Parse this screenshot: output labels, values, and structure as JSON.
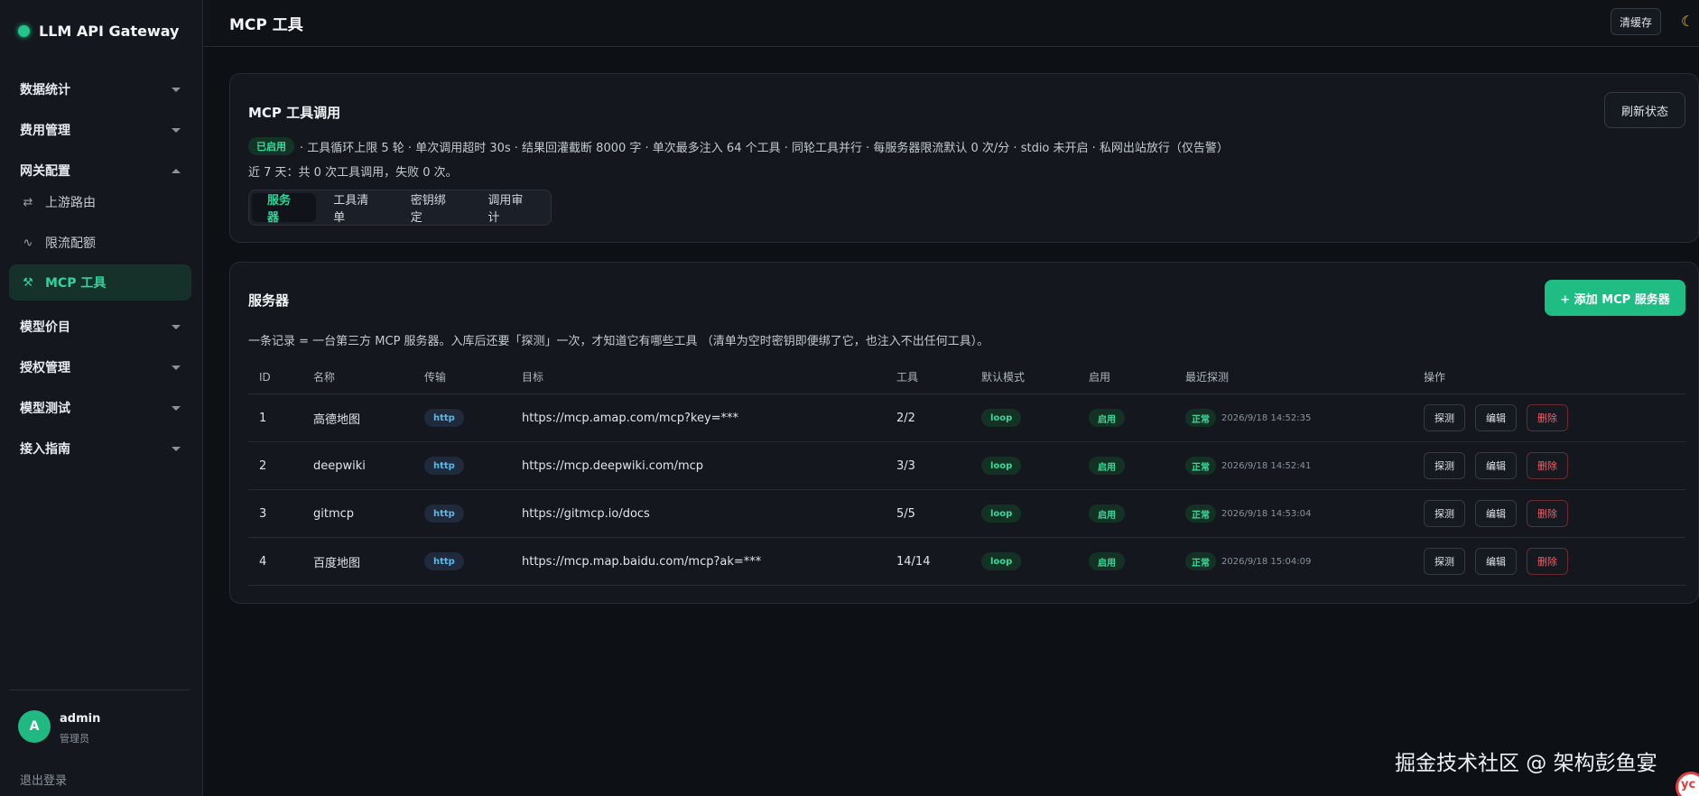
{
  "app": {
    "title": "LLM API Gateway",
    "theme_accent": "#22c58a"
  },
  "sidebar": {
    "groups": [
      {
        "label": "数据统计"
      },
      {
        "label": "费用管理"
      },
      {
        "label": "网关配置",
        "expanded": true
      },
      {
        "label": "模型价目"
      },
      {
        "label": "授权管理"
      },
      {
        "label": "模型测试"
      },
      {
        "label": "接入指南"
      }
    ],
    "sub_items": [
      {
        "label": "上游路由",
        "icon": "swap-icon"
      },
      {
        "label": "限流配额",
        "icon": "wave-icon"
      },
      {
        "label": "MCP 工具",
        "icon": "tools-icon",
        "active": true
      }
    ],
    "user": {
      "avatar": "A",
      "name": "admin",
      "role": "管理员"
    },
    "logout": "退出登录"
  },
  "header": {
    "title": "MCP 工具",
    "clear_cache": "清缓存",
    "theme_icon": "moon-icon"
  },
  "mcp_card": {
    "title": "MCP 工具调用",
    "refresh": "刷新状态",
    "status_badge": "已启用",
    "status_text": "· 工具循环上限 5 轮 · 单次调用超时 30s · 结果回灌截断 8000 字 · 单次最多注入 64 个工具 · 同轮工具并行 · 每服务器限流默认 0 次/分 · stdio 未开启 · 私网出站放行（仅告警）",
    "stats": "近 7 天：共 0 次工具调用，失败 0 次。",
    "tabs": [
      {
        "label": "服务器",
        "active": true
      },
      {
        "label": "工具清单"
      },
      {
        "label": "密钥绑定"
      },
      {
        "label": "调用审计"
      }
    ]
  },
  "servers_card": {
    "title": "服务器",
    "add_button": "+ 添加 MCP 服务器",
    "description": "一条记录 = 一台第三方 MCP 服务器。入库后还要「探测」一次，才知道它有哪些工具 （清单为空时密钥即便绑了它，也注入不出任何工具）。",
    "columns": [
      "ID",
      "名称",
      "传输",
      "目标",
      "工具",
      "默认模式",
      "启用",
      "最近探测",
      "操作"
    ],
    "rows": [
      {
        "id": "1",
        "name": "高德地图",
        "transport": "http",
        "target": "https://mcp.amap.com/mcp?key=***",
        "tools": "2/2",
        "mode": "loop",
        "enabled": "启用",
        "probe_status": "正常",
        "probe_time": "2026/9/18 14:52:35"
      },
      {
        "id": "2",
        "name": "deepwiki",
        "transport": "http",
        "target": "https://mcp.deepwiki.com/mcp",
        "tools": "3/3",
        "mode": "loop",
        "enabled": "启用",
        "probe_status": "正常",
        "probe_time": "2026/9/18 14:52:41"
      },
      {
        "id": "3",
        "name": "gitmcp",
        "transport": "http",
        "target": "https://gitmcp.io/docs",
        "tools": "5/5",
        "mode": "loop",
        "enabled": "启用",
        "probe_status": "正常",
        "probe_time": "2026/9/18 14:53:04"
      },
      {
        "id": "4",
        "name": "百度地图",
        "transport": "http",
        "target": "https://mcp.map.baidu.com/mcp?ak=***",
        "tools": "14/14",
        "mode": "loop",
        "enabled": "启用",
        "probe_status": "正常",
        "probe_time": "2026/9/18 15:04:09"
      }
    ],
    "actions": {
      "probe": "探测",
      "edit": "编辑",
      "delete": "删除"
    }
  },
  "watermark": {
    "text": "掘金技术社区 @ 架构彭鱼宴",
    "logo": "yc"
  }
}
